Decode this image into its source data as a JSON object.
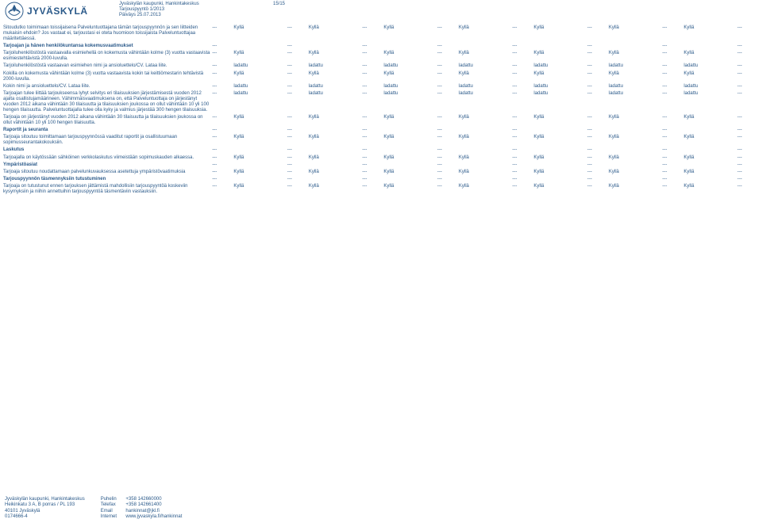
{
  "header": {
    "logo_text": "JYVÄSKYLÄ",
    "org": "Jyväskylän kaupunki, Hankintakeskus",
    "ref": "Tarjouspyyntö 1/2013",
    "date": "Päiväys 25.07.2013",
    "page": "15/15"
  },
  "dash": "---",
  "tick": "Kyllä",
  "file": "ladattu",
  "rows": [
    {
      "label": "Sitoudutko toimimaan toissijaisena Palveluntuottajana tämän tarjouspyynnön ja sen liitteiden mukaisin ehdoin? Jos vastaat ei, tarjoustasi ei oteta huomioon toissijaista Palveluntuottajaa määritettäessä.",
      "type": "tick",
      "bold": false
    },
    {
      "label": "Tarjoajan ja hänen henkilökuntansa kokemusvaatimukset",
      "type": "blank",
      "bold": true
    },
    {
      "label": "Tarjoiluhenkilöstöstä vastaavalla esimiehellä on kokemusta vähintään kolme (3) vuotta vastaavista esimiestehtävistä 2000-luvulla.",
      "type": "tick",
      "bold": false
    },
    {
      "label": "Tarjoiluhenkilöstöstä vastaavan esimiehen nimi ja ansioluettelo/CV. Lataa liite.",
      "type": "file",
      "bold": false
    },
    {
      "label": "Kokilla on kokemusta vähintään kolme (3) vuotta vastaavista kokin tai keittiömestarin tehtävistä 2000-luvulla.",
      "type": "tick",
      "bold": false
    },
    {
      "label": "Kokin nimi ja ansioluettelo/CV. Lataa liite.",
      "type": "file",
      "bold": false
    },
    {
      "label": "Tarjoajan tulee liittää tarjoukseensa lyhyt selvitys eri tilaisuuksien järjestämisestä vuoden 2012 ajalta osallistujamäärineen. Vähimmäisvaatimuksena on, että Palveluntuottaja on järjestänyt vuoden 2012 aikana vähintään 30 tilaisuutta ja tilaisuuksien joukossa on ollut vähintään 10 yli 100 hengen tilaisuutta. Palveluntuottajalla tulee olla kyky ja valmius järjestää 300 hengen tilaisuuksia.",
      "type": "file",
      "bold": false
    },
    {
      "label": "Tarjoaja on järjestänyt vuoden 2012 aikana vähintään 30 tilaisuutta ja tilaisuuksien joukossa on ollut vähintään 10 yli 100 hengen tilaisuutta.",
      "type": "tick",
      "bold": false
    },
    {
      "label": "Raportit ja seuranta",
      "type": "blank",
      "bold": true
    },
    {
      "label": "Tarjoaja sitoutuu toimittamaan tarjouspyynnössä vaaditut raportit ja osallistuumaan sopimusseurantakokouksiin.",
      "type": "tick",
      "bold": false
    },
    {
      "label": "Laskutus",
      "type": "blank",
      "bold": true
    },
    {
      "label": "Tarjoajalla on käytössään sähköinen verkkolaskutus viimeistään sopimuskauden alkaessa.",
      "type": "tick",
      "bold": false
    },
    {
      "label": "Ympäristöasiat",
      "type": "blank",
      "bold": true
    },
    {
      "label": "Tarjoaja sitoutuu noudattamaan palvelunkuvauksessa asetettuja ympäristövaatimuksia",
      "type": "tick",
      "bold": false
    },
    {
      "label": "Tarjouspyynnön täsmennyksiin tutustuminen",
      "type": "blank",
      "bold": true
    },
    {
      "label": "Tarjoaja on tutustunut ennen tarjouksen jättämistä mahdollisiin tarjouspyyntöä koskeviin kysymyksiin ja niihin annettuihin tarjouspyyntöä täsmentäviin vastauksiin.",
      "type": "tick",
      "bold": false
    }
  ],
  "footer": {
    "addr1": "Jyväskylän kaupunki, Hankintakeskus",
    "addr2": "Heikinkatu 3 A, B porras / PL 193",
    "addr3": "40101 Jyväskylä",
    "addr4": "0174666-4",
    "phone_label": "Puhelin",
    "phone": "+358 142660000",
    "fax_label": "Telefax",
    "fax": "+358 142661400",
    "email_label": "Email",
    "email": "hankinnat@jkl.fi",
    "web_label": "Internet",
    "web": "www.jyvaskyla.fi/hankinnat"
  }
}
